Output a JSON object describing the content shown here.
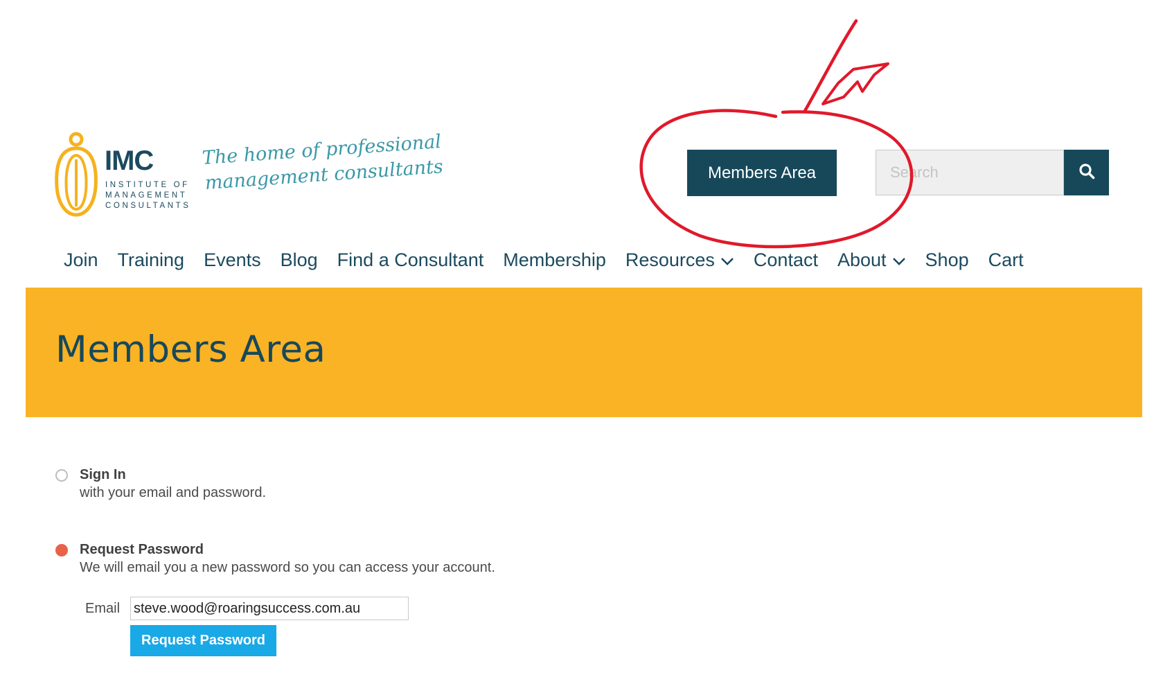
{
  "brand": {
    "acronym": "IMC",
    "subtitle_lines": [
      "INSTITUTE OF",
      "MANAGEMENT",
      "CONSULTANTS"
    ],
    "tagline_lines": [
      "The home of professional",
      "management consultants"
    ],
    "mark_color": "#f5b21e",
    "navy": "#1b4a5e",
    "teal": "#3a98a6"
  },
  "header": {
    "members_area_label": "Members Area",
    "search_placeholder": "Search",
    "search_icon": "search-icon"
  },
  "nav": {
    "items": [
      {
        "label": "Join",
        "has_dropdown": false
      },
      {
        "label": "Training",
        "has_dropdown": false
      },
      {
        "label": "Events",
        "has_dropdown": false
      },
      {
        "label": "Blog",
        "has_dropdown": false
      },
      {
        "label": "Find a Consultant",
        "has_dropdown": false
      },
      {
        "label": "Membership",
        "has_dropdown": false
      },
      {
        "label": "Resources",
        "has_dropdown": true
      },
      {
        "label": "Contact",
        "has_dropdown": false
      },
      {
        "label": "About",
        "has_dropdown": true
      },
      {
        "label": "Shop",
        "has_dropdown": false
      },
      {
        "label": "Cart",
        "has_dropdown": false
      }
    ]
  },
  "banner": {
    "title": "Members Area",
    "background": "#f9b324"
  },
  "login": {
    "sign_in": {
      "title": "Sign In",
      "description": "with your email and password.",
      "selected": false
    },
    "request_password": {
      "title": "Request Password",
      "description": "We will email you a new password so you can access your account.",
      "selected": true
    },
    "email_label": "Email",
    "email_value": "steve.wood@roaringsuccess.com.au",
    "submit_label": "Request Password",
    "submit_color": "#19a9e6"
  },
  "annotation": {
    "color": "#e0192b",
    "shapes": [
      "circle-around-members-area",
      "arrow-pointing-down"
    ]
  }
}
